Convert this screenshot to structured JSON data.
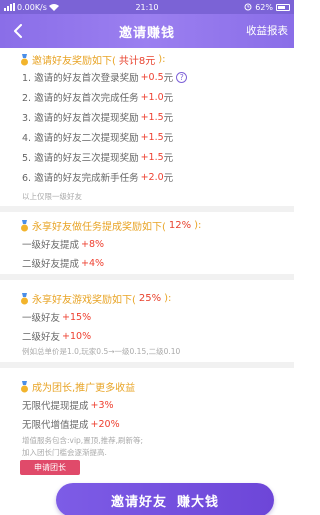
{
  "status_bar": {
    "network_speed": "0.00K/s",
    "time": "21:10",
    "battery": "62%"
  },
  "nav": {
    "title": "邀请赚钱",
    "right_link": "收益报表"
  },
  "section1": {
    "title_prefix": "邀请好友奖励如下(",
    "title_highlight": "共计8元",
    "title_suffix": "):",
    "items": [
      {
        "label": "1. 邀请的好友首次登录奖励",
        "value": "+0.5",
        "unit": "元"
      },
      {
        "label": "2. 邀请的好友首次完成任务",
        "value": "+1.0",
        "unit": "元"
      },
      {
        "label": "3. 邀请的好友首次提现奖励",
        "value": "+1.5",
        "unit": "元"
      },
      {
        "label": "4. 邀请的好友二次提现奖励",
        "value": "+1.5",
        "unit": "元"
      },
      {
        "label": "5. 邀请的好友三次提现奖励",
        "value": "+1.5",
        "unit": "元"
      },
      {
        "label": "6. 邀请的好友完成新手任务",
        "value": "+2.0",
        "unit": "元"
      }
    ],
    "help_mark": "?",
    "note": "以上仅限一级好友"
  },
  "section2": {
    "title_prefix": "永享好友做任务提成奖励如下(",
    "title_highlight": "12%",
    "title_suffix": "):",
    "items": [
      {
        "label": "一级好友提成",
        "value": "+8%"
      },
      {
        "label": "二级好友提成",
        "value": "+4%"
      }
    ]
  },
  "section3": {
    "title_prefix": "永享好友游戏奖励如下(",
    "title_highlight": "25%",
    "title_suffix": "):",
    "items": [
      {
        "label": "一级好友",
        "value": "+15%"
      },
      {
        "label": "二级好友",
        "value": "+10%"
      }
    ],
    "note": "例如总单价是1.0,玩家0.5→一级0.15,二级0.10"
  },
  "section4": {
    "title": "成为团长,推广更多收益",
    "items": [
      {
        "label": "无限代提现提成",
        "value": "+3%"
      },
      {
        "label": "无限代增值提成",
        "value": "+20%"
      }
    ],
    "note1": "增值服务包含:vip,置顶,推荐,刷新等;",
    "note2": "加入团长门槛会逐渐提高.",
    "apply_button": "申请团长"
  },
  "invite_button": {
    "part1": "邀请好友",
    "part2": "赚大钱"
  },
  "colors": {
    "primary": "#8a6ee8",
    "accent_orange": "#e8a426",
    "accent_red": "#ee4030",
    "apply_button": "#e04a6a"
  }
}
